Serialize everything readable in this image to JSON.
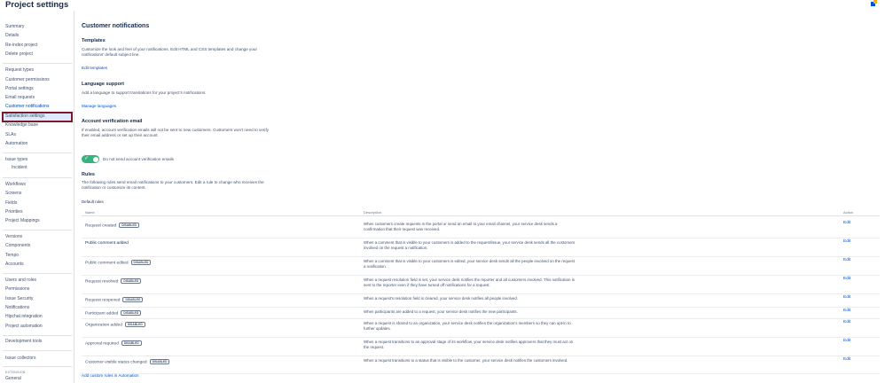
{
  "header": {
    "title": "Project settings"
  },
  "sidebar": {
    "items": [
      "Summary",
      "Details",
      "Re-index project",
      "Delete project",
      "Request types",
      "Customer permissions",
      "Portal settings",
      "Email requests",
      "Customer notifications",
      "Satisfaction settings",
      "Knowledge base",
      "SLAs",
      "Automation",
      "Issue types",
      "Incident",
      "Workflows",
      "Screens",
      "Fields",
      "Priorities",
      "Project Mappings",
      "Versions",
      "Components",
      "Tempo",
      "Accounts",
      "Users and roles",
      "Permissions",
      "Issue Security",
      "Notifications",
      "Hipchat integration",
      "Project automation",
      "Development tools",
      "Issue collectors",
      "EXTENSION",
      "General"
    ],
    "active": "Customer notifications"
  },
  "main": {
    "title": "Customer notifications",
    "templates": {
      "heading": "Templates",
      "text": "Customize the look and feel of your notifications. Edit HTML and CSS templates and change your notifications' default subject line.",
      "link": "Edit templates"
    },
    "language": {
      "heading": "Language support",
      "text": "Add a language to support translations for your project's notifications.",
      "link": "Manage languages"
    },
    "verification": {
      "heading": "Account verification email",
      "text": "If enabled, account verification emails will not be sent to new customers. Customers won't need to verify their email address or set up their account.",
      "toggle_label": "Do not send account verification emails",
      "toggle_on": true
    },
    "rules": {
      "heading": "Rules",
      "text": "The following rules send email notifications to your customers. Edit a rule to change who receives the notification or customize its content.",
      "subheading": "Default rules",
      "columns": {
        "name": "Name",
        "description": "Description",
        "action": "Action"
      },
      "disabled_label": "DISABLED",
      "rows": [
        {
          "name": "Request created",
          "disabled": true,
          "description": "When customers create requests in the portal or send an email to your email channel, your service desk sends a confirmation that their request was received.",
          "action": "Edit"
        },
        {
          "name": "Public comment added",
          "disabled": false,
          "description": "When a comment that is visible to your customers is added to the request/issue, your service desk sends all the customers involved on the request a notification.",
          "action": "Edit"
        },
        {
          "name": "Public comment edited",
          "disabled": true,
          "description": "When a comment that is visible to your customers is edited, your service desk sends all the people involved on the request a notification.",
          "action": "Edit"
        },
        {
          "name": "Request resolved",
          "disabled": true,
          "description": "When a request resolution field is set, your service desk notifies the reporter and all customers involved. This notification is sent to the reporter even if they have turned off notifications for a request.",
          "action": "Edit"
        },
        {
          "name": "Request reopened",
          "disabled": true,
          "description": "When a request's resolution field is cleared, your service desk notifies all people involved.",
          "action": "Edit"
        },
        {
          "name": "Participant added",
          "disabled": true,
          "description": "When participants are added to a request, your service desk notifies the new participants.",
          "action": "Edit"
        },
        {
          "name": "Organization added",
          "disabled": true,
          "description": "When a request is shared to an organization, your service desk notifies the organization's members so they can opt-in to further updates.",
          "action": "Edit"
        },
        {
          "name": "Approval required",
          "disabled": true,
          "description": "When a request transitions to an approval stage of its workflow, your service desk notifies approvers that they must act on the request.",
          "action": "Edit"
        },
        {
          "name": "Customer-visible status changed",
          "disabled": true,
          "description": "When a request transitions to a status that is visible to the customer, your service desk notifies the customers involved.",
          "action": "Edit"
        }
      ],
      "footer_link": "Add custom rules in Automation"
    }
  },
  "colors": {
    "accent": "#0052cc",
    "toggle": "#36b37e",
    "highlight_border": "#7a1a2b"
  }
}
